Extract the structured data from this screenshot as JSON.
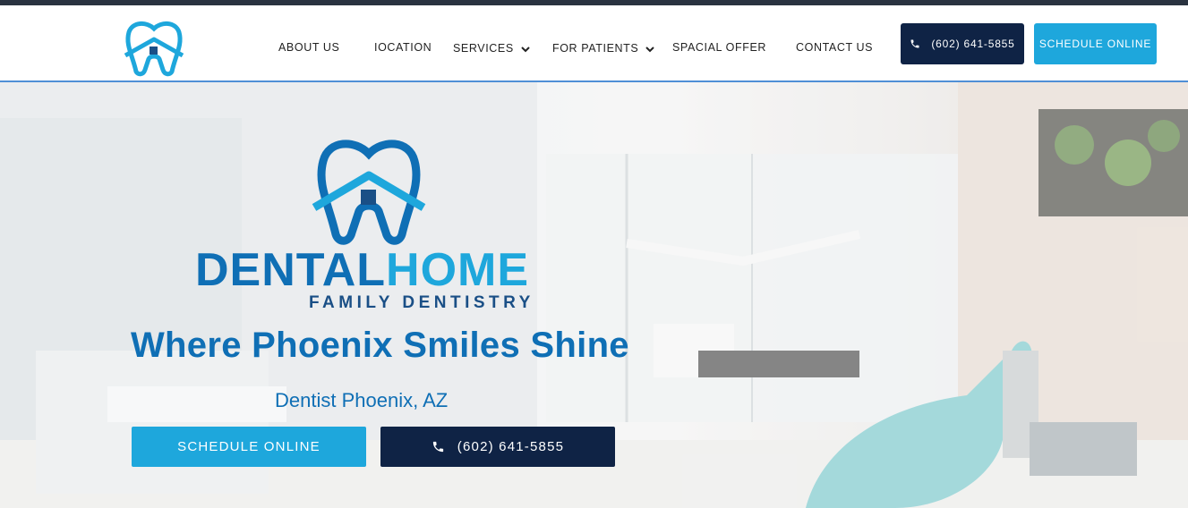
{
  "header": {
    "nav": [
      {
        "label": "ABOUT US",
        "has_dropdown": false
      },
      {
        "label": "IOCATION",
        "has_dropdown": false
      },
      {
        "label": "SERVICES",
        "has_dropdown": true
      },
      {
        "label": "FOR PATIENTS",
        "has_dropdown": true
      },
      {
        "label": "SPACIAL OFFER",
        "has_dropdown": false
      },
      {
        "label": "CONTACT US",
        "has_dropdown": false
      }
    ],
    "phone_button": {
      "label": "(602) 641-5855",
      "icon": "phone-icon"
    },
    "schedule_button": {
      "label": "SCHEDULE ONLINE"
    }
  },
  "hero": {
    "brand_part1": "DENTAL",
    "brand_part2": "HOME",
    "brand_sub": "FAMILY DENTISTRY",
    "headline": "Where Phoenix Smiles Shine",
    "subline": "Dentist Phoenix, AZ",
    "schedule_button": {
      "label": "SCHEDULE ONLINE"
    },
    "phone_button": {
      "label": "(602) 641-5855",
      "icon": "phone-icon"
    }
  },
  "colors": {
    "navy": "#0f2345",
    "accent_blue": "#1ea7dc",
    "brand_blue": "#0f6fb5"
  }
}
